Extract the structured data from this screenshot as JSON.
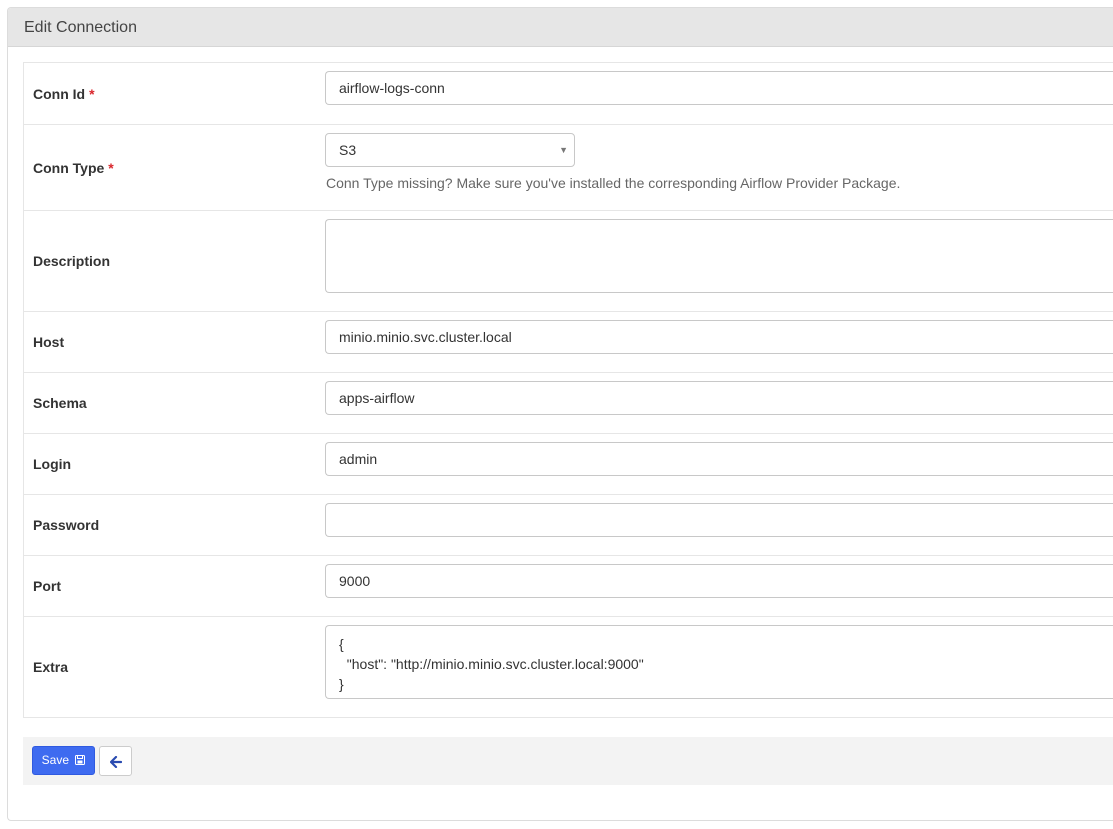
{
  "panel": {
    "title": "Edit Connection"
  },
  "required_marker": "*",
  "fields": {
    "conn_id": {
      "label": "Conn Id",
      "value": "airflow-logs-conn"
    },
    "conn_type": {
      "label": "Conn Type",
      "value": "S3",
      "help": "Conn Type missing? Make sure you've installed the corresponding Airflow Provider Package."
    },
    "description": {
      "label": "Description",
      "value": ""
    },
    "host": {
      "label": "Host",
      "value": "minio.minio.svc.cluster.local"
    },
    "schema": {
      "label": "Schema",
      "value": "apps-airflow"
    },
    "login": {
      "label": "Login",
      "value": "admin"
    },
    "password": {
      "label": "Password",
      "value": ""
    },
    "port": {
      "label": "Port",
      "value": "9000"
    },
    "extra": {
      "label": "Extra",
      "lines": [
        "{",
        "  \"host\": \"http://minio.minio.svc.cluster.local:9000\"",
        "}"
      ]
    }
  },
  "actions": {
    "save_label": "Save"
  },
  "icons": {
    "save": "floppy-disk-icon",
    "back": "arrow-left-icon",
    "dropdown": "caret-down-icon"
  },
  "colors": {
    "primary": "#3e6bf0",
    "required": "#d9262c",
    "header_bg": "#e6e6e6"
  }
}
